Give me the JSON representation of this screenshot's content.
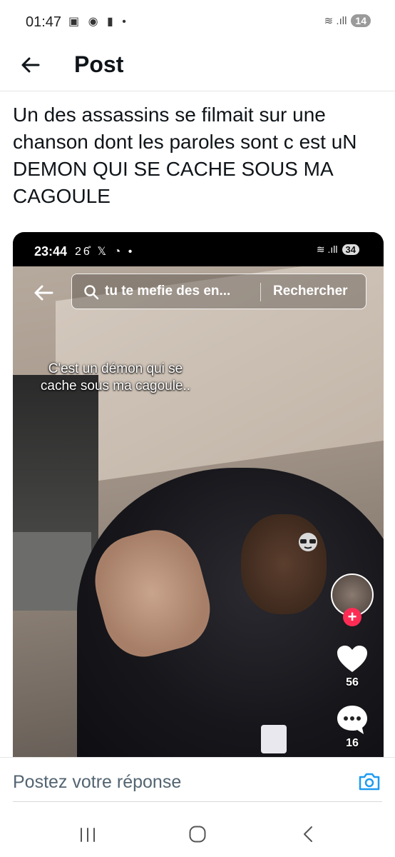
{
  "status_bar": {
    "time": "01:47",
    "icons": "▣ ◉ ▮ •",
    "signal": "≋ .ıll",
    "battery": "14"
  },
  "header": {
    "title": "Post"
  },
  "post": {
    "text": "Un des assassins se filmait sur une chanson dont les paroles sont c est uN DEMON QUI SE CACHE SOUS MA CAGOULE"
  },
  "media": {
    "status_bar": {
      "time": "23:44",
      "icons": "26̊ 𝕏 ◔ •",
      "signal": "≋ .ıll",
      "battery": "34"
    },
    "search": {
      "query": "tu te mefie des en...",
      "button_label": "Rechercher"
    },
    "caption": "C'est un démon qui se cache sous ma cagoule..",
    "actions": {
      "follow_label": "+",
      "like_count": "56",
      "comment_count": "16"
    }
  },
  "reply": {
    "placeholder": "Postez votre réponse"
  },
  "colors": {
    "accent": "#1d9bf0",
    "tiktok_red": "#fe2c55",
    "text_primary": "#0f1419",
    "text_secondary": "#536471"
  }
}
